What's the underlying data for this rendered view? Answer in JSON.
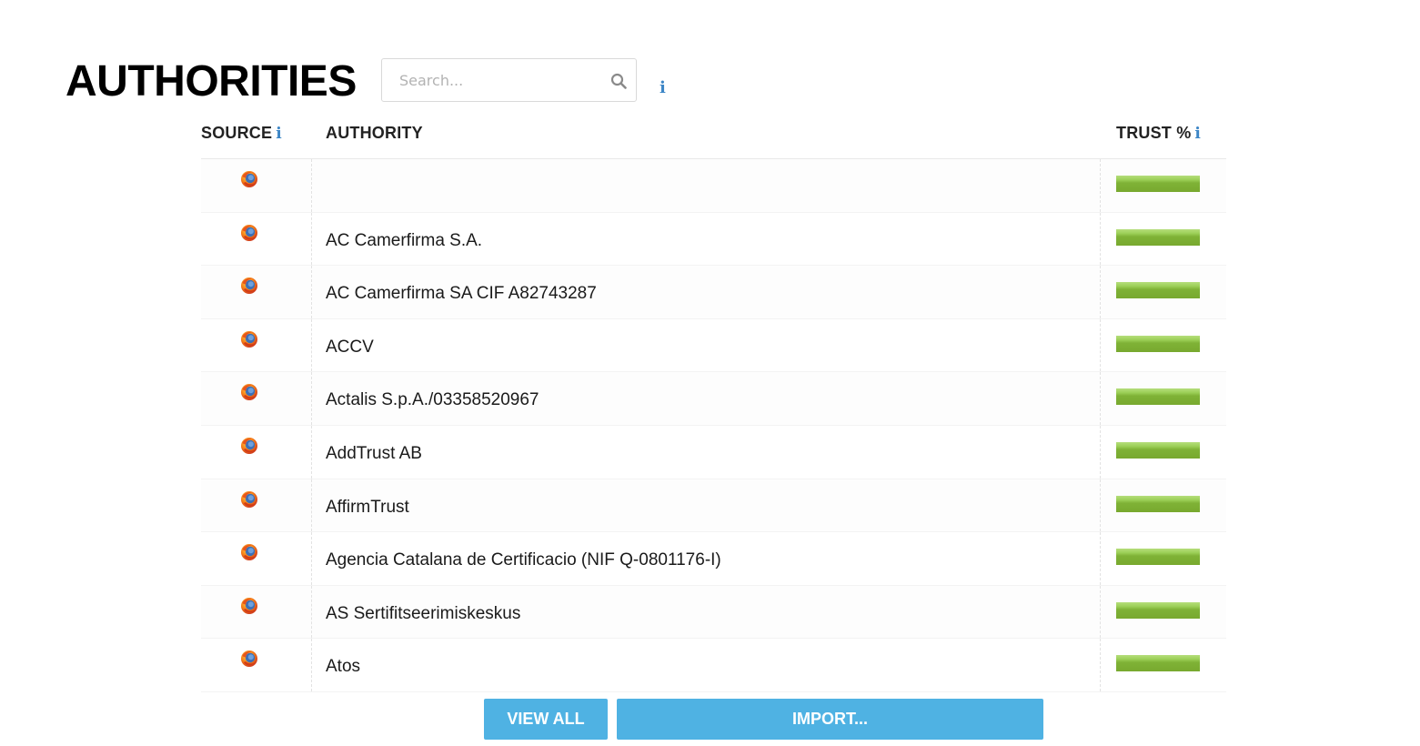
{
  "header": {
    "title": "AUTHORITIES",
    "search_placeholder": "Search..."
  },
  "table": {
    "columns": {
      "source": "SOURCE",
      "authority": "AUTHORITY",
      "trust": "TRUST %"
    },
    "rows": [
      {
        "source_icon": "firefox-icon",
        "authority": "",
        "trust_fraction": 1.0
      },
      {
        "source_icon": "firefox-icon",
        "authority": "AC Camerfirma S.A.",
        "trust_fraction": 1.0
      },
      {
        "source_icon": "firefox-icon",
        "authority": "AC Camerfirma SA CIF A82743287",
        "trust_fraction": 1.0
      },
      {
        "source_icon": "firefox-icon",
        "authority": "ACCV",
        "trust_fraction": 1.0
      },
      {
        "source_icon": "firefox-icon",
        "authority": "Actalis S.p.A./03358520967",
        "trust_fraction": 1.0
      },
      {
        "source_icon": "firefox-icon",
        "authority": "AddTrust AB",
        "trust_fraction": 1.0
      },
      {
        "source_icon": "firefox-icon",
        "authority": "AffirmTrust",
        "trust_fraction": 1.0
      },
      {
        "source_icon": "firefox-icon",
        "authority": "Agencia Catalana de Certificacio (NIF Q-0801176-I)",
        "trust_fraction": 1.0
      },
      {
        "source_icon": "firefox-icon",
        "authority": "AS Sertifitseerimiskeskus",
        "trust_fraction": 1.0
      },
      {
        "source_icon": "firefox-icon",
        "authority": "Atos",
        "trust_fraction": 1.0
      }
    ]
  },
  "buttons": {
    "view_all": "VIEW ALL",
    "import": "IMPORT..."
  },
  "colors": {
    "accent": "#4fb2e3",
    "info": "#3d86c6",
    "trust_bar": "#7fb236"
  }
}
